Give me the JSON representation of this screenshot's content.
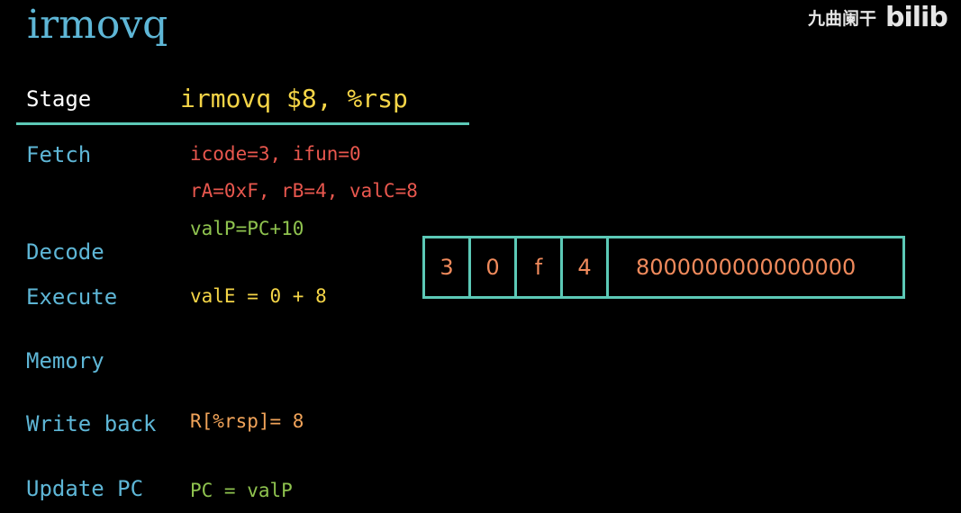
{
  "title": "irmovq",
  "watermark": {
    "text": "九曲阑干",
    "logo": "bilib"
  },
  "header": {
    "stage_label": "Stage",
    "instruction": "irmovq $8, %rsp"
  },
  "stages": {
    "fetch": "Fetch",
    "decode": "Decode",
    "execute": "Execute",
    "memory": "Memory",
    "write_back": "Write back",
    "update_pc": "Update PC"
  },
  "details": {
    "fetch_line1": "icode=3, ifun=0",
    "fetch_line2": "rA=0xF, rB=4, valC=8",
    "fetch_line3": "valP=PC+10",
    "execute": "valE = 0 + 8",
    "write_back": "R[%rsp]= 8",
    "update_pc": "PC = valP"
  },
  "encoding": {
    "bytes": [
      "3",
      "0",
      "f",
      "4"
    ],
    "valc": "8000000000000000"
  },
  "colors": {
    "title": "#5eb6d6",
    "stage": "#5eb6d6",
    "accent_rule": "#5cc9b7",
    "instruction": "#f5d547",
    "fetch_red": "#e8574e",
    "fetch_green": "#8fc34f",
    "execute_yellow": "#f5d547",
    "writeback_orange": "#f2a45a",
    "update_green": "#8fc34f",
    "encoding_text": "#f08a5c"
  }
}
